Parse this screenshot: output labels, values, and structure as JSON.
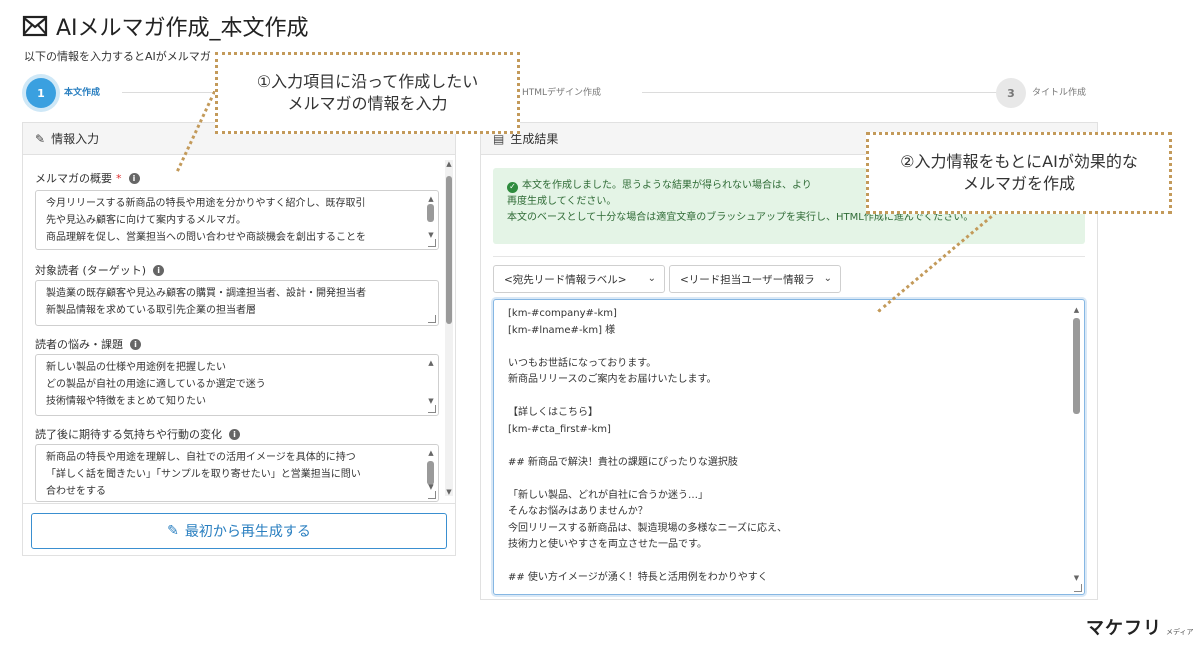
{
  "page": {
    "title": "AIメルマガ作成_本文作成",
    "subtitle": "以下の情報を入力するとAIがメルマガ"
  },
  "stepper": {
    "steps": [
      {
        "number": "1",
        "label": "本文作成"
      },
      {
        "label": "HTMLデザイン作成"
      },
      {
        "number": "3",
        "label": "タイトル作成"
      }
    ]
  },
  "left_panel": {
    "header": "情報入力",
    "fields": [
      {
        "label": "メルマガの概要",
        "required_mark": "*",
        "lines": [
          "今月リリースする新商品の特長や用途を分かりやすく紹介し、既存取引",
          "先や見込み顧客に向けて案内するメルマガ。",
          "商品理解を促し、営業担当への問い合わせや商談機会を創出することを"
        ]
      },
      {
        "label": "対象読者 (ターゲット)",
        "lines": [
          "製造業の既存顧客や見込み顧客の購買・調達担当者、設計・開発担当者",
          "新製品情報を求めている取引先企業の担当者層"
        ]
      },
      {
        "label": "読者の悩み・課題",
        "lines": [
          "新しい製品の仕様や用途例を把握したい",
          "どの製品が自社の用途に適しているか選定で迷う",
          "技術情報や特徴をまとめて知りたい"
        ]
      },
      {
        "label": "読了後に期待する気持ちや行動の変化",
        "lines": [
          "新商品の特長や用途を理解し、自社での活用イメージを具体的に持つ",
          "「詳しく話を聞きたい」「サンプルを取り寄せたい」と営業担当に問い",
          "合わせをする"
        ]
      }
    ],
    "regen_button": "最初から再生成する"
  },
  "right_panel": {
    "header": "生成結果",
    "success_lines": [
      "本文を作成しました。思うような結果が得られない場合は、より",
      "再度生成してください。",
      "本文のベースとして十分な場合は適宜文章のブラッシュアップを実行し、HTML作成に進んでください。"
    ],
    "select_1": "<宛先リード情報ラベル>",
    "select_2": "<リード担当ユーザー情報ラ",
    "output_lines": [
      "[km-#company#-km]",
      "[km-#lname#-km] 様",
      "",
      "いつもお世話になっております。",
      "新商品リリースのご案内をお届けいたします。",
      "",
      "【詳しくはこちら】",
      "[km-#cta_first#-km]",
      "",
      "## 新商品で解決！貴社の課題にぴったりな選択肢",
      "",
      "「新しい製品、どれが自社に合うか迷う…」",
      "そんなお悩みはありませんか？",
      "今回リリースする新商品は、製造現場の多様なニーズに応え、",
      "技術力と使いやすさを両立させた一品です。",
      "",
      "## 使い方イメージが湧く！特長と活用例をわかりやすく"
    ]
  },
  "callouts": {
    "callout_1": [
      "①入力項目に沿って作成したい",
      "メルマガの情報を入力"
    ],
    "callout_2": [
      "②入力情報をもとにAIが効果的な",
      "メルマガを作成"
    ]
  },
  "brand": {
    "main": "マケフリ",
    "sub": "メディア"
  }
}
